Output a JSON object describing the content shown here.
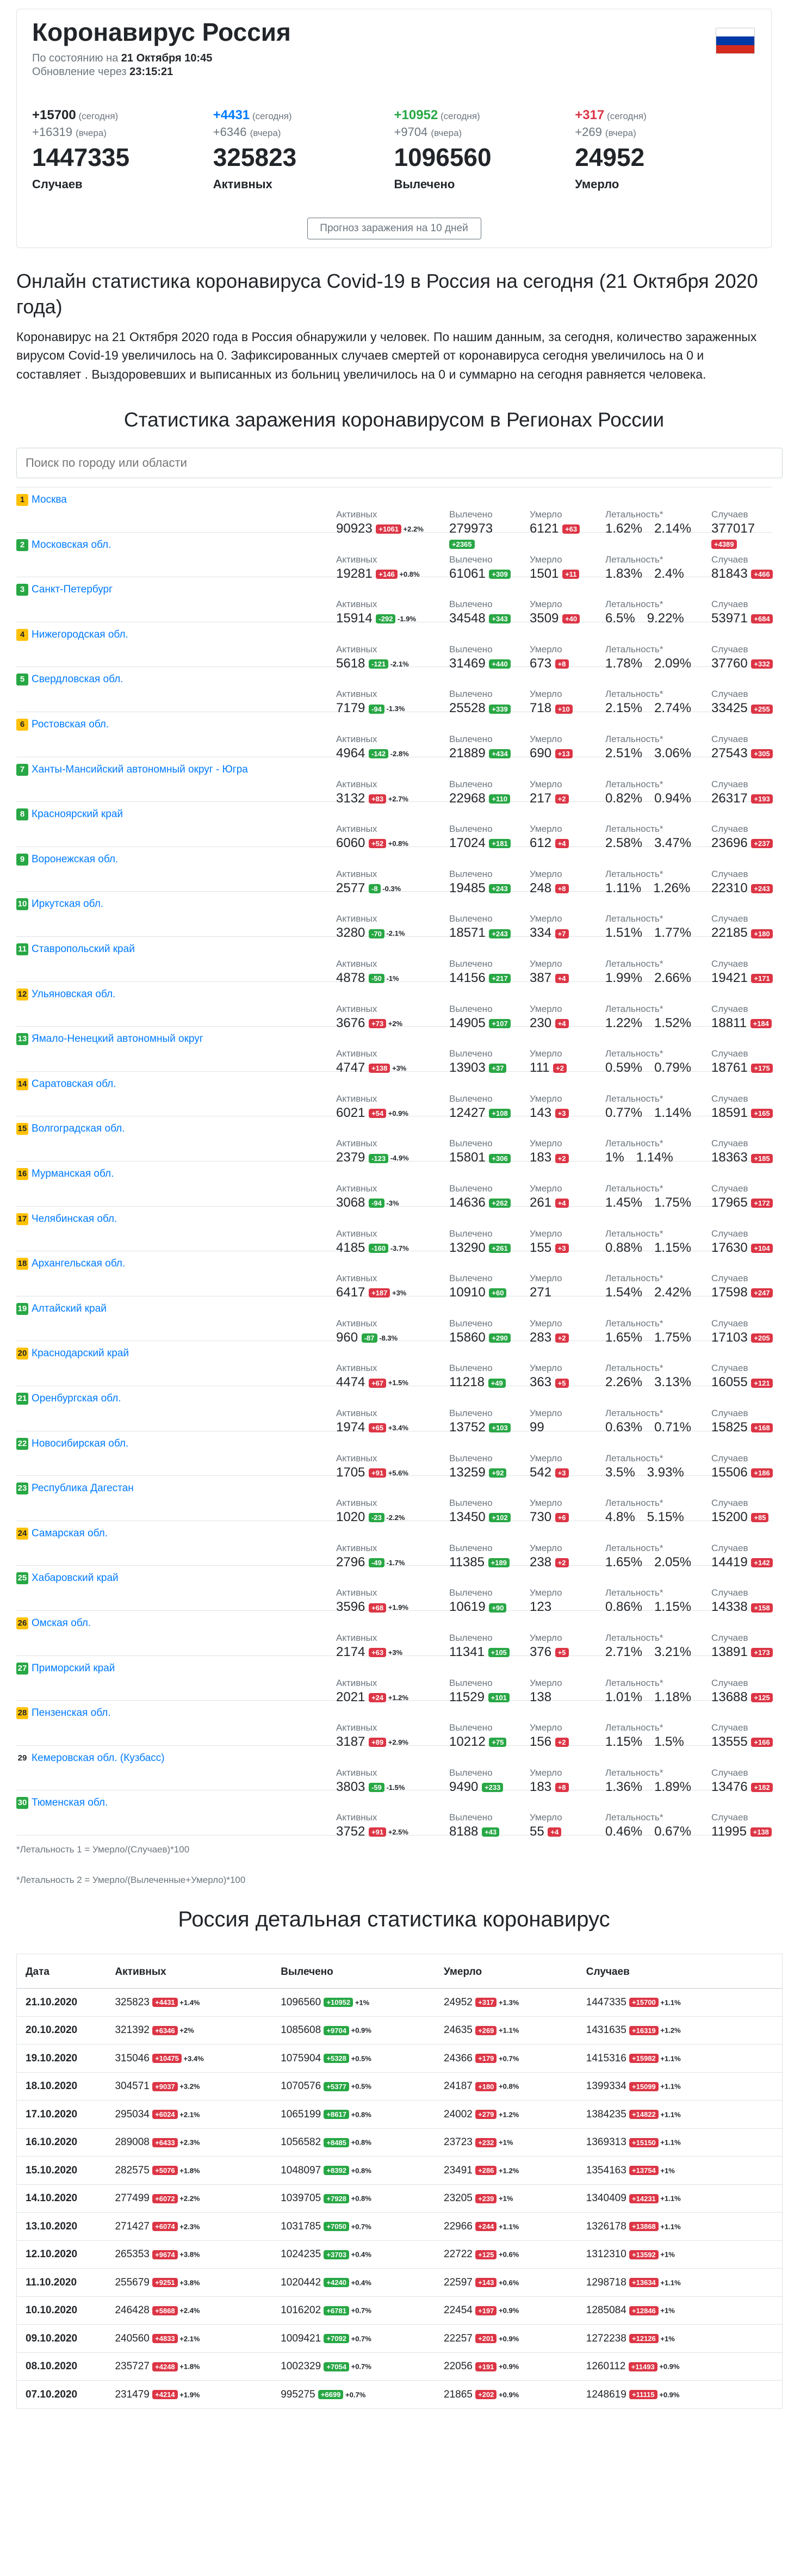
{
  "header": {
    "title": "Коронавирус Россия",
    "asof_label": "По состоянию на",
    "asof_value": "21 Октября 10:45",
    "update_label": "Обновление через",
    "update_value": "23:15:21",
    "forecast_button": "Прогноз заражения на 10 дней",
    "flag_colors": [
      "#ffffff",
      "#0039a6",
      "#d52b1e"
    ]
  },
  "stats": [
    {
      "today": "+15700",
      "today_lbl": "(сегодня)",
      "yest": "+16319",
      "yest_lbl": "(вчера)",
      "total": "1447335",
      "label": "Случаев",
      "color": "#212529"
    },
    {
      "today": "+4431",
      "today_lbl": "(сегодня)",
      "yest": "+6346",
      "yest_lbl": "(вчера)",
      "total": "325823",
      "label": "Активных",
      "color": "#007bff"
    },
    {
      "today": "+10952",
      "today_lbl": "(сегодня)",
      "yest": "+9704",
      "yest_lbl": "(вчера)",
      "total": "1096560",
      "label": "Вылечено",
      "color": "#28a745"
    },
    {
      "today": "+317",
      "today_lbl": "(сегодня)",
      "yest": "+269",
      "yest_lbl": "(вчера)",
      "total": "24952",
      "label": "Умерло",
      "color": "#dc3545"
    }
  ],
  "online_title": "Онлайн статистика коронавируса Covid-19 в Россия на сегодня (21 Октября 2020 года)",
  "description": "Коронавирус на 21 Октября 2020 года в Россия обнаружили у человек. По нашим данным, за сегодня, количество зараженных вирусом Covid-19 увеличилось на 0. Зафиксированных случаев смертей от коронавируса сегодня увеличилось на 0 и составляет . Выздоровевших и выписанных из больниц увеличилось на 0 и суммарно на сегодня равняется человека.",
  "regions_title": "Статистика заражения коронавирусом в Регионах России",
  "search_placeholder": "Поиск по городу или области",
  "col_labels": {
    "active": "Активных",
    "recovered": "Вылечено",
    "died": "Умерло",
    "lethal": "Летальность*",
    "cases": "Случаев"
  },
  "regions": [
    {
      "n": "1",
      "name": "Москва",
      "active": "90923",
      "ab": "+1061",
      "ap": "+2.2%",
      "rec": "279973",
      "rb": "+2365",
      "died": "6121",
      "db": "+63",
      "l1": "1.62%",
      "l2": "2.14%",
      "cases": "377017",
      "cb": "+4389"
    },
    {
      "n": "2",
      "name": "Московская обл.",
      "active": "19281",
      "ab": "+146",
      "ap": "+0.8%",
      "rec": "61061",
      "rb": "+309",
      "died": "1501",
      "db": "+11",
      "l1": "1.83%",
      "l2": "2.4%",
      "cases": "81843",
      "cb": "+466"
    },
    {
      "n": "3",
      "name": "Санкт-Петербург",
      "active": "15914",
      "ab": "-292",
      "ap": "-1.9%",
      "rec": "34548",
      "rb": "+343",
      "died": "3509",
      "db": "+40",
      "l1": "6.5%",
      "l2": "9.22%",
      "cases": "53971",
      "cb": "+684"
    },
    {
      "n": "4",
      "name": "Нижегородская обл.",
      "active": "5618",
      "ab": "-121",
      "ap": "-2.1%",
      "rec": "31469",
      "rb": "+440",
      "died": "673",
      "db": "+8",
      "l1": "1.78%",
      "l2": "2.09%",
      "cases": "37760",
      "cb": "+332"
    },
    {
      "n": "5",
      "name": "Свердловская обл.",
      "active": "7179",
      "ab": "-94",
      "ap": "-1.3%",
      "rec": "25528",
      "rb": "+339",
      "died": "718",
      "db": "+10",
      "l1": "2.15%",
      "l2": "2.74%",
      "cases": "33425",
      "cb": "+255"
    },
    {
      "n": "6",
      "name": "Ростовская обл.",
      "active": "4964",
      "ab": "-142",
      "ap": "-2.8%",
      "rec": "21889",
      "rb": "+434",
      "died": "690",
      "db": "+13",
      "l1": "2.51%",
      "l2": "3.06%",
      "cases": "27543",
      "cb": "+305"
    },
    {
      "n": "7",
      "name": "Ханты-Мансийский автономный округ - Югра",
      "active": "3132",
      "ab": "+83",
      "ap": "+2.7%",
      "rec": "22968",
      "rb": "+110",
      "died": "217",
      "db": "+2",
      "l1": "0.82%",
      "l2": "0.94%",
      "cases": "26317",
      "cb": "+193"
    },
    {
      "n": "8",
      "name": "Красноярский край",
      "active": "6060",
      "ab": "+52",
      "ap": "+0.8%",
      "rec": "17024",
      "rb": "+181",
      "died": "612",
      "db": "+4",
      "l1": "2.58%",
      "l2": "3.47%",
      "cases": "23696",
      "cb": "+237"
    },
    {
      "n": "9",
      "name": "Воронежская обл.",
      "active": "2577",
      "ab": "-8",
      "ap": "-0.3%",
      "rec": "19485",
      "rb": "+243",
      "died": "248",
      "db": "+8",
      "l1": "1.11%",
      "l2": "1.26%",
      "cases": "22310",
      "cb": "+243"
    },
    {
      "n": "10",
      "name": "Иркутская обл.",
      "active": "3280",
      "ab": "-70",
      "ap": "-2.1%",
      "rec": "18571",
      "rb": "+243",
      "died": "334",
      "db": "+7",
      "l1": "1.51%",
      "l2": "1.77%",
      "cases": "22185",
      "cb": "+180"
    },
    {
      "n": "11",
      "name": "Ставропольский край",
      "active": "4878",
      "ab": "-50",
      "ap": "-1%",
      "rec": "14156",
      "rb": "+217",
      "died": "387",
      "db": "+4",
      "l1": "1.99%",
      "l2": "2.66%",
      "cases": "19421",
      "cb": "+171"
    },
    {
      "n": "12",
      "name": "Ульяновская обл.",
      "active": "3676",
      "ab": "+73",
      "ap": "+2%",
      "rec": "14905",
      "rb": "+107",
      "died": "230",
      "db": "+4",
      "l1": "1.22%",
      "l2": "1.52%",
      "cases": "18811",
      "cb": "+184"
    },
    {
      "n": "13",
      "name": "Ямало-Ненецкий автономный округ",
      "active": "4747",
      "ab": "+138",
      "ap": "+3%",
      "rec": "13903",
      "rb": "+37",
      "died": "111",
      "db": "+2",
      "l1": "0.59%",
      "l2": "0.79%",
      "cases": "18761",
      "cb": "+175"
    },
    {
      "n": "14",
      "name": "Саратовская обл.",
      "active": "6021",
      "ab": "+54",
      "ap": "+0.9%",
      "rec": "12427",
      "rb": "+108",
      "died": "143",
      "db": "+3",
      "l1": "0.77%",
      "l2": "1.14%",
      "cases": "18591",
      "cb": "+165"
    },
    {
      "n": "15",
      "name": "Волгоградская обл.",
      "active": "2379",
      "ab": "-123",
      "ap": "-4.9%",
      "rec": "15801",
      "rb": "+306",
      "died": "183",
      "db": "+2",
      "l1": "1%",
      "l2": "1.14%",
      "cases": "18363",
      "cb": "+185"
    },
    {
      "n": "16",
      "name": "Мурманская обл.",
      "active": "3068",
      "ab": "-94",
      "ap": "-3%",
      "rec": "14636",
      "rb": "+262",
      "died": "261",
      "db": "+4",
      "l1": "1.45%",
      "l2": "1.75%",
      "cases": "17965",
      "cb": "+172"
    },
    {
      "n": "17",
      "name": "Челябинская обл.",
      "active": "4185",
      "ab": "-160",
      "ap": "-3.7%",
      "rec": "13290",
      "rb": "+261",
      "died": "155",
      "db": "+3",
      "l1": "0.88%",
      "l2": "1.15%",
      "cases": "17630",
      "cb": "+104"
    },
    {
      "n": "18",
      "name": "Архангельская обл.",
      "active": "6417",
      "ab": "+187",
      "ap": "+3%",
      "rec": "10910",
      "rb": "+60",
      "died": "271",
      "db": "",
      "l1": "1.54%",
      "l2": "2.42%",
      "cases": "17598",
      "cb": "+247"
    },
    {
      "n": "19",
      "name": "Алтайский край",
      "active": "960",
      "ab": "-87",
      "ap": "-8.3%",
      "rec": "15860",
      "rb": "+290",
      "died": "283",
      "db": "+2",
      "l1": "1.65%",
      "l2": "1.75%",
      "cases": "17103",
      "cb": "+205"
    },
    {
      "n": "20",
      "name": "Краснодарский край",
      "active": "4474",
      "ab": "+67",
      "ap": "+1.5%",
      "rec": "11218",
      "rb": "+49",
      "died": "363",
      "db": "+5",
      "l1": "2.26%",
      "l2": "3.13%",
      "cases": "16055",
      "cb": "+121"
    },
    {
      "n": "21",
      "name": "Оренбургская обл.",
      "active": "1974",
      "ab": "+65",
      "ap": "+3.4%",
      "rec": "13752",
      "rb": "+103",
      "died": "99",
      "db": "",
      "l1": "0.63%",
      "l2": "0.71%",
      "cases": "15825",
      "cb": "+168"
    },
    {
      "n": "22",
      "name": "Новосибирская обл.",
      "active": "1705",
      "ab": "+91",
      "ap": "+5.6%",
      "rec": "13259",
      "rb": "+92",
      "died": "542",
      "db": "+3",
      "l1": "3.5%",
      "l2": "3.93%",
      "cases": "15506",
      "cb": "+186"
    },
    {
      "n": "23",
      "name": "Республика Дагестан",
      "active": "1020",
      "ab": "-23",
      "ap": "-2.2%",
      "rec": "13450",
      "rb": "+102",
      "died": "730",
      "db": "+6",
      "l1": "4.8%",
      "l2": "5.15%",
      "cases": "15200",
      "cb": "+85"
    },
    {
      "n": "24",
      "name": "Самарская обл.",
      "active": "2796",
      "ab": "-49",
      "ap": "-1.7%",
      "rec": "11385",
      "rb": "+189",
      "died": "238",
      "db": "+2",
      "l1": "1.65%",
      "l2": "2.05%",
      "cases": "14419",
      "cb": "+142"
    },
    {
      "n": "25",
      "name": "Хабаровский край",
      "active": "3596",
      "ab": "+68",
      "ap": "+1.9%",
      "rec": "10619",
      "rb": "+90",
      "died": "123",
      "db": "",
      "l1": "0.86%",
      "l2": "1.15%",
      "cases": "14338",
      "cb": "+158"
    },
    {
      "n": "26",
      "name": "Омская обл.",
      "active": "2174",
      "ab": "+63",
      "ap": "+3%",
      "rec": "11341",
      "rb": "+105",
      "died": "376",
      "db": "+5",
      "l1": "2.71%",
      "l2": "3.21%",
      "cases": "13891",
      "cb": "+173"
    },
    {
      "n": "27",
      "name": "Приморский край",
      "active": "2021",
      "ab": "+24",
      "ap": "+1.2%",
      "rec": "11529",
      "rb": "+101",
      "died": "138",
      "db": "",
      "l1": "1.01%",
      "l2": "1.18%",
      "cases": "13688",
      "cb": "+125"
    },
    {
      "n": "28",
      "name": "Пензенская обл.",
      "active": "3187",
      "ab": "+89",
      "ap": "+2.9%",
      "rec": "10212",
      "rb": "+75",
      "died": "156",
      "db": "+2",
      "l1": "1.15%",
      "l2": "1.5%",
      "cases": "13555",
      "cb": "+166"
    },
    {
      "n": "29",
      "name": "Кемеровская обл. (Кузбасс)",
      "active": "3803",
      "ab": "-59",
      "ap": "-1.5%",
      "rec": "9490",
      "rb": "+233",
      "died": "183",
      "db": "+8",
      "l1": "1.36%",
      "l2": "1.89%",
      "cases": "13476",
      "cb": "+182"
    },
    {
      "n": "30",
      "name": "Тюменская обл.",
      "active": "3752",
      "ab": "+91",
      "ap": "+2.5%",
      "rec": "8188",
      "rb": "+43",
      "died": "55",
      "db": "+4",
      "l1": "0.46%",
      "l2": "0.67%",
      "cases": "11995",
      "cb": "+138"
    }
  ],
  "footnote1": "*Летальность 1 = Умерло/(Случаев)*100",
  "footnote2": "*Летальность 2 = Умерло/(Вылеченные+Умерло)*100",
  "detail_title": "Россия детальная статистика коронавирус",
  "table_headers": [
    "Дата",
    "Активных",
    "Вылечено",
    "Умерло",
    "Случаев"
  ],
  "table_rows": [
    [
      "21.10.2020",
      "325823",
      "+4431",
      "+1.4%",
      "1096560",
      "+10952",
      "+1%",
      "24952",
      "+317",
      "+1.3%",
      "1447335",
      "+15700",
      "+1.1%"
    ],
    [
      "20.10.2020",
      "321392",
      "+6346",
      "+2%",
      "1085608",
      "+9704",
      "+0.9%",
      "24635",
      "+269",
      "+1.1%",
      "1431635",
      "+16319",
      "+1.2%"
    ],
    [
      "19.10.2020",
      "315046",
      "+10475",
      "+3.4%",
      "1075904",
      "+5328",
      "+0.5%",
      "24366",
      "+179",
      "+0.7%",
      "1415316",
      "+15982",
      "+1.1%"
    ],
    [
      "18.10.2020",
      "304571",
      "+9037",
      "+3.2%",
      "1070576",
      "+5377",
      "+0.5%",
      "24187",
      "+180",
      "+0.8%",
      "1399334",
      "+15099",
      "+1.1%"
    ],
    [
      "17.10.2020",
      "295034",
      "+6024",
      "+2.1%",
      "1065199",
      "+8617",
      "+0.8%",
      "24002",
      "+279",
      "+1.2%",
      "1384235",
      "+14822",
      "+1.1%"
    ],
    [
      "16.10.2020",
      "289008",
      "+6433",
      "+2.3%",
      "1056582",
      "+8485",
      "+0.8%",
      "23723",
      "+232",
      "+1%",
      "1369313",
      "+15150",
      "+1.1%"
    ],
    [
      "15.10.2020",
      "282575",
      "+5076",
      "+1.8%",
      "1048097",
      "+8392",
      "+0.8%",
      "23491",
      "+286",
      "+1.2%",
      "1354163",
      "+13754",
      "+1%"
    ],
    [
      "14.10.2020",
      "277499",
      "+6072",
      "+2.2%",
      "1039705",
      "+7928",
      "+0.8%",
      "23205",
      "+239",
      "+1%",
      "1340409",
      "+14231",
      "+1.1%"
    ],
    [
      "13.10.2020",
      "271427",
      "+6074",
      "+2.3%",
      "1031785",
      "+7050",
      "+0.7%",
      "22966",
      "+244",
      "+1.1%",
      "1326178",
      "+13868",
      "+1.1%"
    ],
    [
      "12.10.2020",
      "265353",
      "+9674",
      "+3.8%",
      "1024235",
      "+3703",
      "+0.4%",
      "22722",
      "+125",
      "+0.6%",
      "1312310",
      "+13592",
      "+1%"
    ],
    [
      "11.10.2020",
      "255679",
      "+9251",
      "+3.8%",
      "1020442",
      "+4240",
      "+0.4%",
      "22597",
      "+143",
      "+0.6%",
      "1298718",
      "+13634",
      "+1.1%"
    ],
    [
      "10.10.2020",
      "246428",
      "+5868",
      "+2.4%",
      "1016202",
      "+6781",
      "+0.7%",
      "22454",
      "+197",
      "+0.9%",
      "1285084",
      "+12846",
      "+1%"
    ],
    [
      "09.10.2020",
      "240560",
      "+4833",
      "+2.1%",
      "1009421",
      "+7092",
      "+0.7%",
      "22257",
      "+201",
      "+0.9%",
      "1272238",
      "+12126",
      "+1%"
    ],
    [
      "08.10.2020",
      "235727",
      "+4248",
      "+1.8%",
      "1002329",
      "+7054",
      "+0.7%",
      "22056",
      "+191",
      "+0.9%",
      "1260112",
      "+11493",
      "+0.9%"
    ],
    [
      "07.10.2020",
      "231479",
      "+4214",
      "+1.9%",
      "995275",
      "+6699",
      "+0.7%",
      "21865",
      "+202",
      "+0.9%",
      "1248619",
      "+11115",
      "+0.9%"
    ]
  ]
}
